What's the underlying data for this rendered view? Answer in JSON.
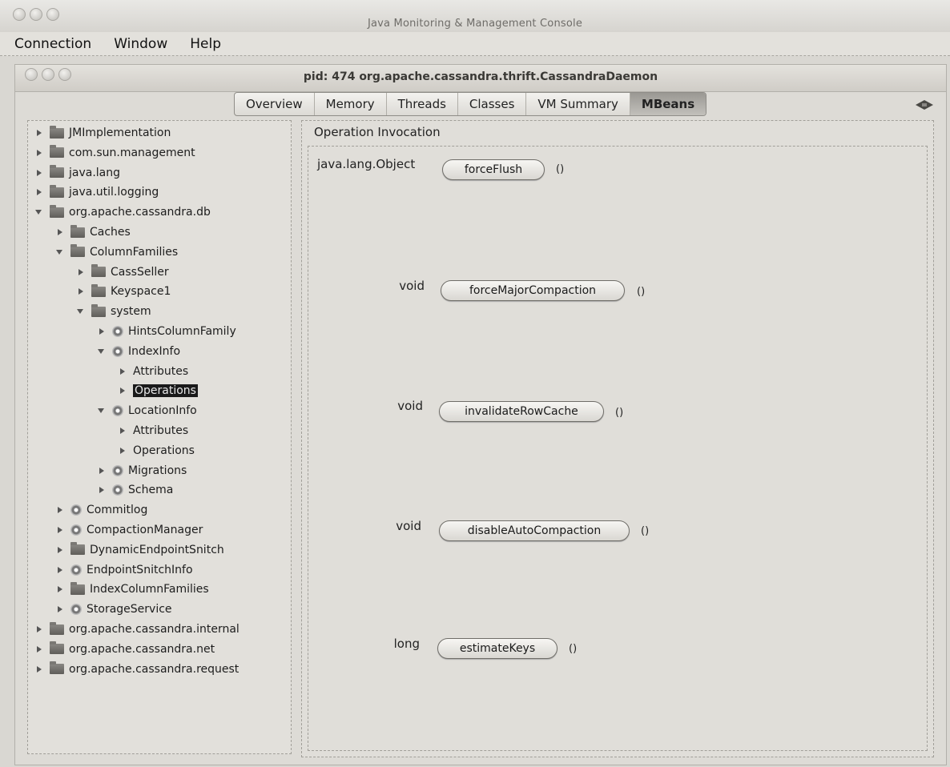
{
  "app": {
    "title": "Java Monitoring & Management Console"
  },
  "menu": {
    "items": [
      "Connection",
      "Window",
      "Help"
    ]
  },
  "inner_window": {
    "title": "pid: 474 org.apache.cassandra.thrift.CassandraDaemon"
  },
  "tabs": {
    "items": [
      "Overview",
      "Memory",
      "Threads",
      "Classes",
      "VM Summary",
      "MBeans"
    ],
    "selected": "MBeans"
  },
  "tree": {
    "items": [
      {
        "label": "JMImplementation",
        "icon": "folder-icon",
        "expanded": false
      },
      {
        "label": "com.sun.management",
        "icon": "folder-icon",
        "expanded": false
      },
      {
        "label": "java.lang",
        "icon": "folder-icon",
        "expanded": false
      },
      {
        "label": "java.util.logging",
        "icon": "folder-icon",
        "expanded": false
      },
      {
        "label": "org.apache.cassandra.db",
        "icon": "folder-icon",
        "expanded": true
      },
      {
        "label": "Caches",
        "icon": "folder-icon",
        "expanded": false
      },
      {
        "label": "ColumnFamilies",
        "icon": "folder-icon",
        "expanded": true
      },
      {
        "label": "CassSeller",
        "icon": "folder-icon",
        "expanded": false
      },
      {
        "label": "Keyspace1",
        "icon": "folder-icon",
        "expanded": false
      },
      {
        "label": "system",
        "icon": "folder-icon",
        "expanded": true
      },
      {
        "label": "HintsColumnFamily",
        "icon": "bean-icon",
        "expanded": false
      },
      {
        "label": "IndexInfo",
        "icon": "bean-icon",
        "expanded": true
      },
      {
        "label": "Attributes",
        "icon": "none",
        "expanded": false
      },
      {
        "label": "Operations",
        "icon": "none",
        "expanded": false,
        "selected": true
      },
      {
        "label": "LocationInfo",
        "icon": "bean-icon",
        "expanded": true
      },
      {
        "label": "Attributes",
        "icon": "none",
        "expanded": false
      },
      {
        "label": "Operations",
        "icon": "none",
        "expanded": false
      },
      {
        "label": "Migrations",
        "icon": "bean-icon",
        "expanded": false
      },
      {
        "label": "Schema",
        "icon": "bean-icon",
        "expanded": false
      },
      {
        "label": "Commitlog",
        "icon": "bean-icon",
        "expanded": false
      },
      {
        "label": "CompactionManager",
        "icon": "bean-icon",
        "expanded": false
      },
      {
        "label": "DynamicEndpointSnitch",
        "icon": "folder-icon",
        "expanded": false
      },
      {
        "label": "EndpointSnitchInfo",
        "icon": "bean-icon",
        "expanded": false
      },
      {
        "label": "IndexColumnFamilies",
        "icon": "folder-icon",
        "expanded": false
      },
      {
        "label": "StorageService",
        "icon": "bean-icon",
        "expanded": false
      },
      {
        "label": "org.apache.cassandra.internal",
        "icon": "folder-icon",
        "expanded": false
      },
      {
        "label": "org.apache.cassandra.net",
        "icon": "folder-icon",
        "expanded": false
      },
      {
        "label": "org.apache.cassandra.request",
        "icon": "folder-icon",
        "expanded": false
      }
    ]
  },
  "operation_panel": {
    "header": "Operation Invocation",
    "operations": [
      {
        "return_type": "java.lang.Object",
        "name": "forceFlush",
        "params": "()"
      },
      {
        "return_type": "void",
        "name": "forceMajorCompaction",
        "params": "()"
      },
      {
        "return_type": "void",
        "name": "invalidateRowCache",
        "params": "()"
      },
      {
        "return_type": "void",
        "name": "disableAutoCompaction",
        "params": "()"
      },
      {
        "return_type": "long",
        "name": "estimateKeys",
        "params": "()"
      }
    ]
  }
}
